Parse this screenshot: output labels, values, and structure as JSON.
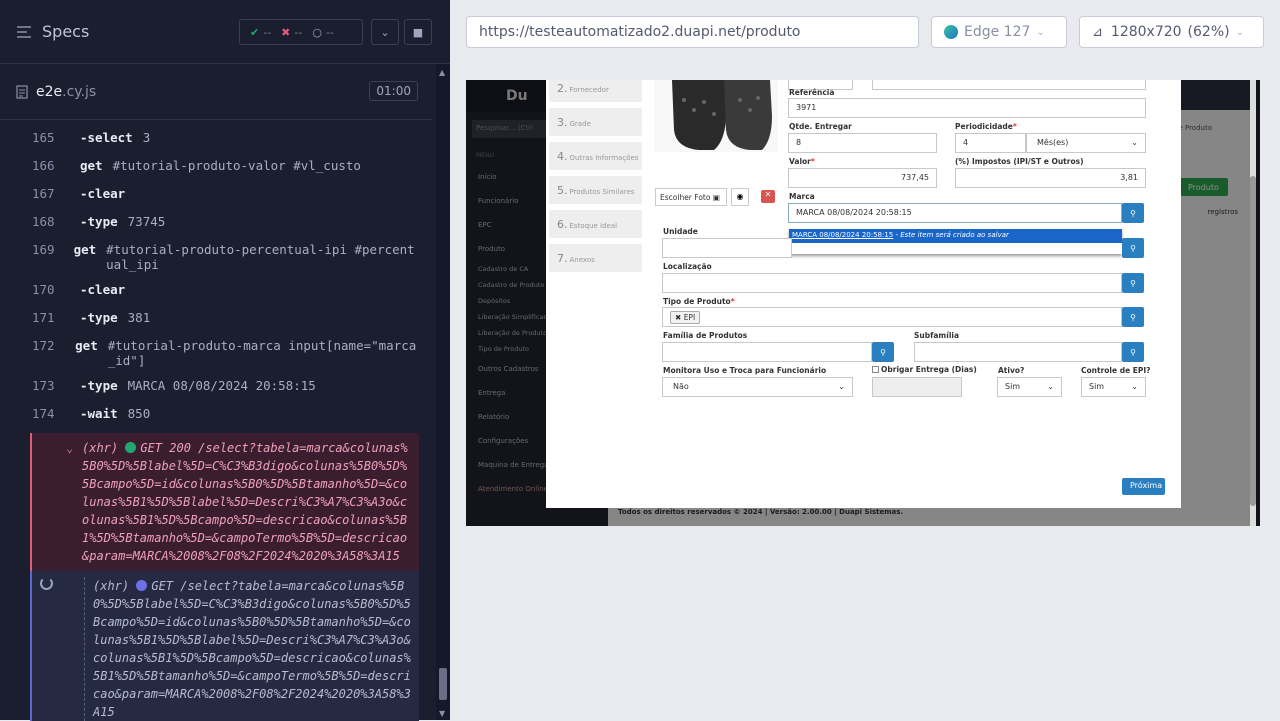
{
  "runner": {
    "title": "Specs",
    "stats": {
      "passed": "--",
      "failed": "--",
      "pending": "--"
    },
    "file": {
      "name": "e2e",
      "ext": ".cy.js",
      "time": "01:00"
    },
    "commands": [
      {
        "num": "165",
        "name": "select",
        "arg": "3",
        "chained": true
      },
      {
        "num": "166",
        "name": "get",
        "arg": "#tutorial-produto-valor #vl_custo",
        "chained": false
      },
      {
        "num": "167",
        "name": "clear",
        "arg": "",
        "chained": true
      },
      {
        "num": "168",
        "name": "type",
        "arg": "73745",
        "chained": true
      },
      {
        "num": "169",
        "name": "get",
        "arg": "#tutorial-produto-percentual-ipi #percentual_ipi",
        "chained": false
      },
      {
        "num": "170",
        "name": "clear",
        "arg": "",
        "chained": true
      },
      {
        "num": "171",
        "name": "type",
        "arg": "381",
        "chained": true
      },
      {
        "num": "172",
        "name": "get",
        "arg": "#tutorial-produto-marca input[name=\"marca_id\"]",
        "chained": false
      },
      {
        "num": "173",
        "name": "type",
        "arg": "MARCA 08/08/2024 20:58:15",
        "chained": true
      },
      {
        "num": "174",
        "name": "wait",
        "arg": "850",
        "chained": true
      }
    ],
    "xhr_done": {
      "label": "(xhr)",
      "text": "GET 200 /select?tabela=marca&colunas%5B0%5D%5Blabel%5D=C%C3%B3digo&colunas%5B0%5D%5Bcampo%5D=id&colunas%5B0%5D%5Btamanho%5D=&colunas%5B1%5D%5Blabel%5D=Descri%C3%A7%C3%A3o&colunas%5B1%5D%5Bcampo%5D=descricao&colunas%5B1%5D%5Btamanho%5D=&campoTermo%5B%5D=descricao&param=MARCA%2008%2F08%2F2024%2020%3A58%3A15"
    },
    "xhr_pending": {
      "label": "(xhr)",
      "text": "GET /select?tabela=marca&colunas%5B0%5D%5Blabel%5D=C%C3%B3digo&colunas%5B0%5D%5Bcampo%5D=id&colunas%5B0%5D%5Btamanho%5D=&colunas%5B1%5D%5Blabel%5D=Descri%C3%A7%C3%A3o&colunas%5B1%5D%5Bcampo%5D=descricao&colunas%5B1%5D%5Btamanho%5D=&campoTermo%5B%5D=descricao&param=MARCA%2008%2F08%2F2024%2020%3A58%3A15"
    }
  },
  "address": {
    "url": "https://testeautomatizado2.duapi.net/produto",
    "browser": "Edge 127",
    "viewport": "1280x720",
    "scale": "(62%)"
  },
  "app": {
    "sidebar": [
      "Início",
      "Funcionário",
      "EPC",
      "Produto",
      "Cadastro de CA",
      "Cadastro de Produto",
      "Depósitos",
      "Liberação Simplificada",
      "Liberação de Produto",
      "Tipo de Produto",
      "Outros Cadastros",
      "Entrega",
      "Relatório",
      "Configurações",
      "Maquina de Entrega",
      "Atendimento Online"
    ],
    "search_placeholder": "Pesquisar... (Ctrl",
    "menu_label": "MENU",
    "footer": "Todos os direitos reservados © 2024 | Versão: 2.00.00 | Duapi Sistemas.",
    "steps": [
      {
        "n": "2.",
        "label": "Fornecedor"
      },
      {
        "n": "3.",
        "label": "Grade"
      },
      {
        "n": "4.",
        "label": "Outras Informações"
      },
      {
        "n": "5.",
        "label": "Produtos Similares"
      },
      {
        "n": "6.",
        "label": "Estoque Ideal"
      },
      {
        "n": "7.",
        "label": "Anexos"
      }
    ],
    "form": {
      "referencia_label": "Referência",
      "referencia": "3971",
      "qtde_label": "Qtde. Entregar",
      "qtde": "8",
      "periodicidade_label": "Periodicidade",
      "periodicidade": "4",
      "periodicidade_unit": "Mês(es)",
      "valor_label": "Valor",
      "valor": "737,45",
      "impostos_label": "(%) Impostos (IPI/ST e Outros)",
      "impostos": "3,81",
      "marca_label": "Marca",
      "marca": "MARCA 08/08/2024 20:58:15",
      "suggest_link": "MARCA 08/08/2024 20:58:15",
      "suggest_note": " - Este item será criado ao salvar",
      "unidade_label": "Unidade",
      "localizacao_label": "Localização",
      "tipo_label": "Tipo de Produto",
      "tipo_tag": "EPI",
      "familia_label": "Família de Produtos",
      "subfamilia_label": "Subfamília",
      "monitora_label": "Monitora Uso e Troca para Funcionário",
      "monitora": "Não",
      "obrigar_label": "Obrigar Entrega (Dias)",
      "ativo_label": "Ativo?",
      "ativo": "Sim",
      "controle_label": "Controle de EPI?",
      "controle": "Sim",
      "foto_btn": "Escolher Foto",
      "next_btn": "Próxima"
    },
    "bg": {
      "produto_btn": "Produto",
      "registros": "registros",
      "crumb": "Cadastro de Produto"
    }
  }
}
